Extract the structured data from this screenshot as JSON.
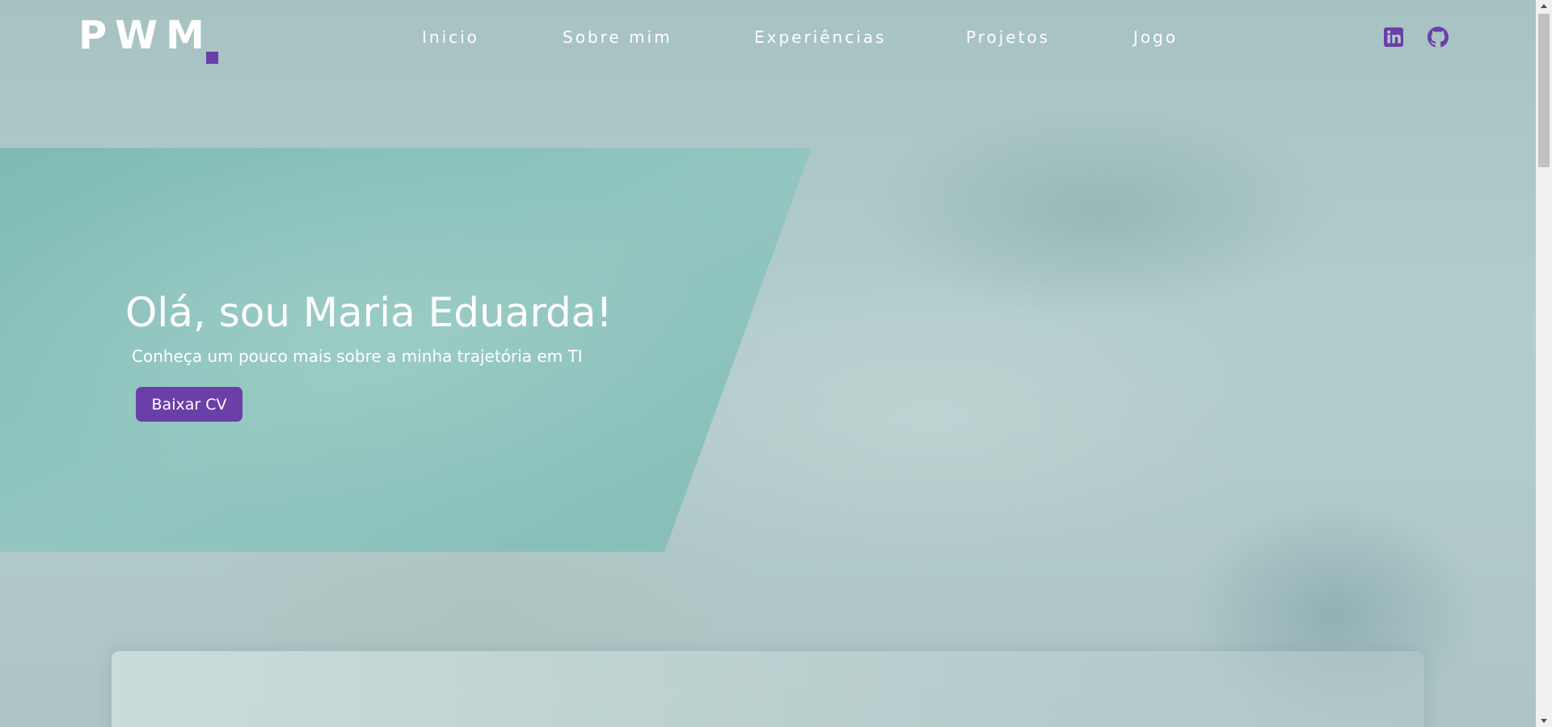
{
  "header": {
    "logo_text": "PWM",
    "nav": [
      {
        "label": "Inicio"
      },
      {
        "label": "Sobre mim"
      },
      {
        "label": "Experiências"
      },
      {
        "label": "Projetos"
      },
      {
        "label": "Jogo"
      }
    ],
    "social": [
      {
        "icon": "linkedin-icon"
      },
      {
        "icon": "github-icon"
      }
    ]
  },
  "hero": {
    "title": "Olá, sou Maria Eduarda!",
    "subtitle": "Conheça um pouco mais sobre a minha trajetória em TI",
    "button_label": "Baixar CV"
  },
  "colors": {
    "accent": "#6a3fa8",
    "hero_panel": "#86beb8",
    "background": "#b4cccc",
    "text": "#ffffff"
  }
}
